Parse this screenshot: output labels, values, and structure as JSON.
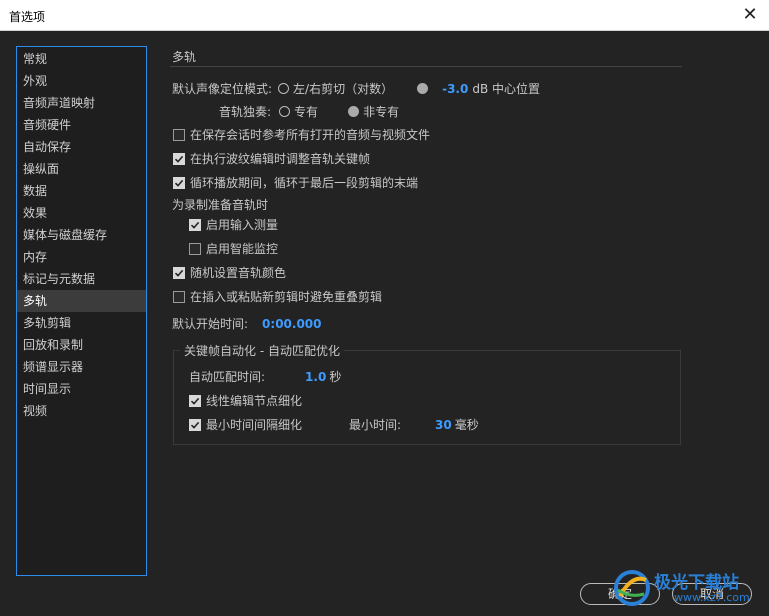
{
  "window": {
    "title": "首选项"
  },
  "sidebar": {
    "items": [
      {
        "label": "常规",
        "active": false
      },
      {
        "label": "外观",
        "active": false
      },
      {
        "label": "音频声道映射",
        "active": false
      },
      {
        "label": "音频硬件",
        "active": false
      },
      {
        "label": "自动保存",
        "active": false
      },
      {
        "label": "操纵面",
        "active": false
      },
      {
        "label": "数据",
        "active": false
      },
      {
        "label": "效果",
        "active": false
      },
      {
        "label": "媒体与磁盘缓存",
        "active": false
      },
      {
        "label": "内存",
        "active": false
      },
      {
        "label": "标记与元数据",
        "active": false
      },
      {
        "label": "多轨",
        "active": true
      },
      {
        "label": "多轨剪辑",
        "active": false
      },
      {
        "label": "回放和录制",
        "active": false
      },
      {
        "label": "频谱显示器",
        "active": false
      },
      {
        "label": "时间显示",
        "active": false
      },
      {
        "label": "视频",
        "active": false
      }
    ]
  },
  "panel": {
    "title": "多轨",
    "pan_mode": {
      "label": "默认声像定位模式:",
      "option1": "左/右剪切（对数）",
      "option2_value": "-3.0",
      "option2_unit": "dB 中心位置",
      "selected": 2
    },
    "solo": {
      "label": "音轨独奏:",
      "option1": "专有",
      "option2": "非专有",
      "selected": 2
    },
    "cb_save_references": {
      "label": "在保存会话时参考所有打开的音频与视频文件",
      "checked": false
    },
    "cb_ripple": {
      "label": "在执行波纹编辑时调整音轨关键帧",
      "checked": true
    },
    "cb_loop": {
      "label": "循环播放期间，循环于最后一段剪辑的末端",
      "checked": true
    },
    "arm_heading": "为录制准备音轨时",
    "cb_input_meter": {
      "label": "启用输入测量",
      "checked": true
    },
    "cb_smart_monitor": {
      "label": "启用智能监控",
      "checked": false
    },
    "cb_random_color": {
      "label": "随机设置音轨颜色",
      "checked": true
    },
    "cb_avoid_overlap": {
      "label": "在插入或粘贴新剪辑时避免重叠剪辑",
      "checked": false
    },
    "default_start": {
      "label": "默认开始时间:",
      "value": "0:00.000"
    }
  },
  "keyframe_group": {
    "title": "关键帧自动化 - 自动匹配优化",
    "auto_match": {
      "label": "自动匹配时间:",
      "value": "1.0",
      "unit": "秒"
    },
    "cb_linear": {
      "label": "线性编辑节点细化",
      "checked": true
    },
    "cb_min_interval": {
      "label": "最小时间间隔细化",
      "checked": true
    },
    "min_time": {
      "label": "最小时间:",
      "value": "30",
      "unit": "毫秒"
    }
  },
  "buttons": {
    "ok": "确定",
    "cancel": "取消"
  },
  "watermark": {
    "brand": "极光下载站",
    "url": "www.xz7.com"
  },
  "colors": {
    "accent": "#3d9bff",
    "selection": "#2d8ceb"
  }
}
